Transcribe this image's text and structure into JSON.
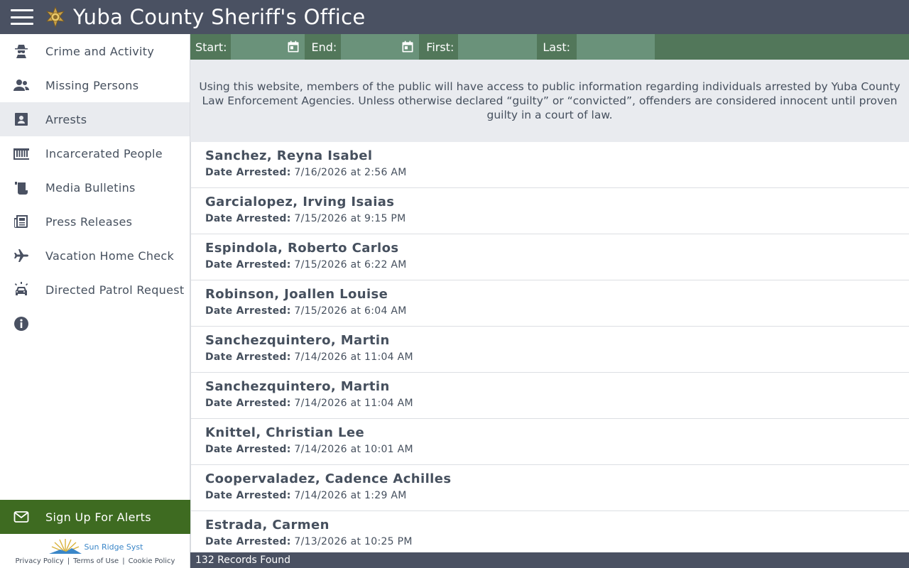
{
  "header": {
    "title": "Yuba County Sheriff's Office"
  },
  "sidebar": {
    "items": [
      {
        "label": "Crime and Activity",
        "icon": "detective-icon",
        "active": false
      },
      {
        "label": "Missing Persons",
        "icon": "people-icon",
        "active": false
      },
      {
        "label": "Arrests",
        "icon": "id-badge-icon",
        "active": true
      },
      {
        "label": "Incarcerated People",
        "icon": "jail-bars-icon",
        "active": false
      },
      {
        "label": "Media Bulletins",
        "icon": "scroll-icon",
        "active": false
      },
      {
        "label": "Press Releases",
        "icon": "newspaper-icon",
        "active": false
      },
      {
        "label": "Vacation Home Check",
        "icon": "plane-icon",
        "active": false
      },
      {
        "label": "Directed Patrol Request",
        "icon": "police-car-icon",
        "active": false
      },
      {
        "label": "",
        "icon": "info-icon",
        "active": false
      }
    ],
    "alerts_label": "Sign Up For Alerts",
    "vendor_name": "Sun Ridge Syst",
    "footer_links": [
      "Privacy Policy",
      "Terms of Use",
      "Cookie Policy"
    ]
  },
  "filters": {
    "start_label": "Start:",
    "end_label": "End:",
    "first_label": "First:",
    "last_label": "Last:",
    "start_value": "",
    "end_value": "",
    "first_value": "",
    "last_value": ""
  },
  "notice": "Using this website, members of the public will have access to public information regarding individuals arrested by Yuba County Law Enforcement Agencies. Unless otherwise declared “guilty” or “convicted”, offenders are considered innocent until proven guilty in a court of law.",
  "arrests": {
    "date_label": "Date Arrested:",
    "records": [
      {
        "name": "Sanchez, Reyna Isabel",
        "date": "7/16/2026 at 2:56 AM"
      },
      {
        "name": "Garcialopez, Irving Isaias",
        "date": "7/15/2026 at 9:15 PM"
      },
      {
        "name": "Espindola, Roberto Carlos",
        "date": "7/15/2026 at 6:22 AM"
      },
      {
        "name": "Robinson, Joallen Louise",
        "date": "7/15/2026 at 6:04 AM"
      },
      {
        "name": "Sanchezquintero, Martin",
        "date": "7/14/2026 at 11:04 AM"
      },
      {
        "name": "Sanchezquintero, Martin",
        "date": "7/14/2026 at 11:04 AM"
      },
      {
        "name": "Knittel, Christian Lee",
        "date": "7/14/2026 at 10:01 AM"
      },
      {
        "name": "Coopervaladez, Cadence Achilles",
        "date": "7/14/2026 at 1:29 AM"
      },
      {
        "name": "Estrada, Carmen",
        "date": "7/13/2026 at 10:25 PM"
      }
    ]
  },
  "status": "132 Records Found",
  "colors": {
    "header": "#4a5162",
    "filterbar": "#52775a",
    "alerts": "#3e6b21",
    "active_nav": "#e9ebef"
  }
}
